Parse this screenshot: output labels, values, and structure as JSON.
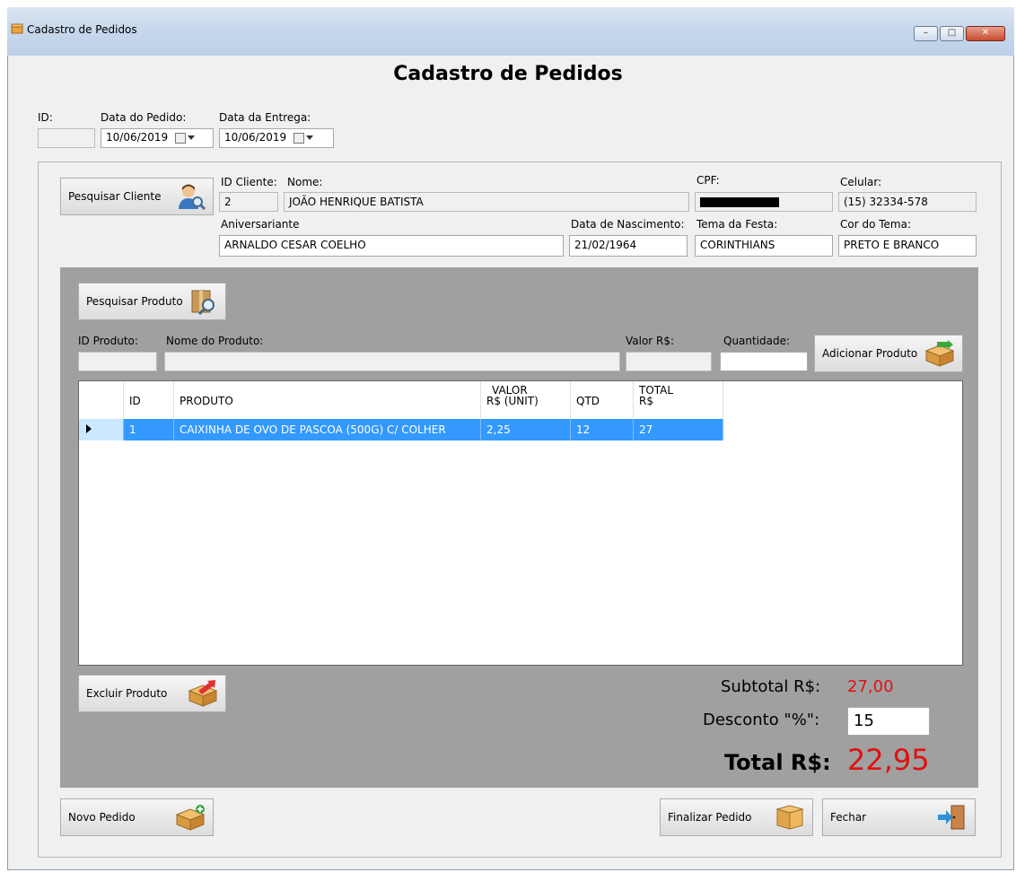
{
  "window": {
    "title": "Cadastro de Pedidos",
    "minimize": "–",
    "maximize": "□",
    "close": "✕"
  },
  "header": {
    "title": "Cadastro de Pedidos"
  },
  "order": {
    "id_label": "ID:",
    "id_value": "",
    "date_label": "Data do Pedido:",
    "date_value": "10/06/2019",
    "delivery_label": "Data da Entrega:",
    "delivery_value": "10/06/2019"
  },
  "client": {
    "search_button": "Pesquisar Cliente",
    "id_label": "ID Cliente:",
    "id_value": "2",
    "name_label": "Nome:",
    "name_value": "JOÃO HENRIQUE BATISTA",
    "cpf_label": "CPF:",
    "phone_label": "Celular:",
    "phone_value": "(15) 32334-578",
    "birthday_person_label": "Aniversariante",
    "birthday_person_value": "ARNALDO CESAR COELHO",
    "birthdate_label": "Data de Nascimento:",
    "birthdate_value": "21/02/1964",
    "theme_label": "Tema da Festa:",
    "theme_value": "CORINTHIANS",
    "theme_color_label": "Cor do Tema:",
    "theme_color_value": "PRETO E BRANCO"
  },
  "product": {
    "search_button": "Pesquisar Produto",
    "id_label": "ID Produto:",
    "id_value": "",
    "name_label": "Nome do Produto:",
    "name_value": "",
    "price_label": "Valor R$:",
    "price_value": "",
    "qty_label": "Quantidade:",
    "qty_value": "",
    "add_button": "Adicionar Produto"
  },
  "grid": {
    "headers": {
      "id": "ID",
      "product": "PRODUTO",
      "unit_value_1": "VALOR",
      "unit_value_2": "R$ (UNIT)",
      "qty": "QTD",
      "total_1": "TOTAL",
      "total_2": "R$"
    },
    "rows": [
      {
        "id": "1",
        "product": "CAIXINHA DE OVO DE PASCOA (500G) C/ COLHER",
        "unit_value": "2,25",
        "qty": "12",
        "total": "27"
      }
    ]
  },
  "remove_button": "Excluir Produto",
  "summary": {
    "subtotal_label": "Subtotal R$:",
    "subtotal_value": "27,00",
    "discount_label": "Desconto \"%\":",
    "discount_value": "15",
    "total_label": "Total R$:",
    "total_value": "22,95"
  },
  "footer": {
    "new_order": "Novo Pedido",
    "finish_order": "Finalizar Pedido",
    "close": "Fechar"
  },
  "colors": {
    "selection": "#3399ff",
    "accent_red": "#e01010",
    "panel_grey": "#a0a0a0"
  }
}
